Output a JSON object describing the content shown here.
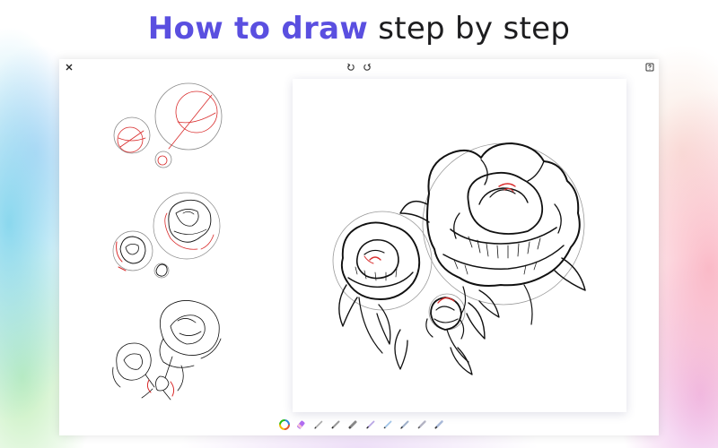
{
  "headline": {
    "accent": "How to draw",
    "rest": "step by step"
  },
  "colors": {
    "accent": "#5a4fe0",
    "guide_red": "#d92b2b",
    "ink": "#111111",
    "guide_gray": "#8a8a8a"
  },
  "topbar": {
    "close_icon": "close-icon",
    "undo_icon": "undo-icon",
    "redo_icon": "redo-icon",
    "help_icon": "help-icon"
  },
  "steps": [
    {
      "name": "step-1-guides"
    },
    {
      "name": "step-2-sketch"
    },
    {
      "name": "step-3-outline"
    }
  ],
  "toolbar": {
    "tools": [
      "color-wheel-icon",
      "eraser-icon",
      "pencil-icon",
      "pen-icon",
      "marker-icon",
      "brush-icon",
      "fineliner-icon",
      "ink-pen-icon",
      "airbrush-icon",
      "calligraphy-icon"
    ]
  }
}
